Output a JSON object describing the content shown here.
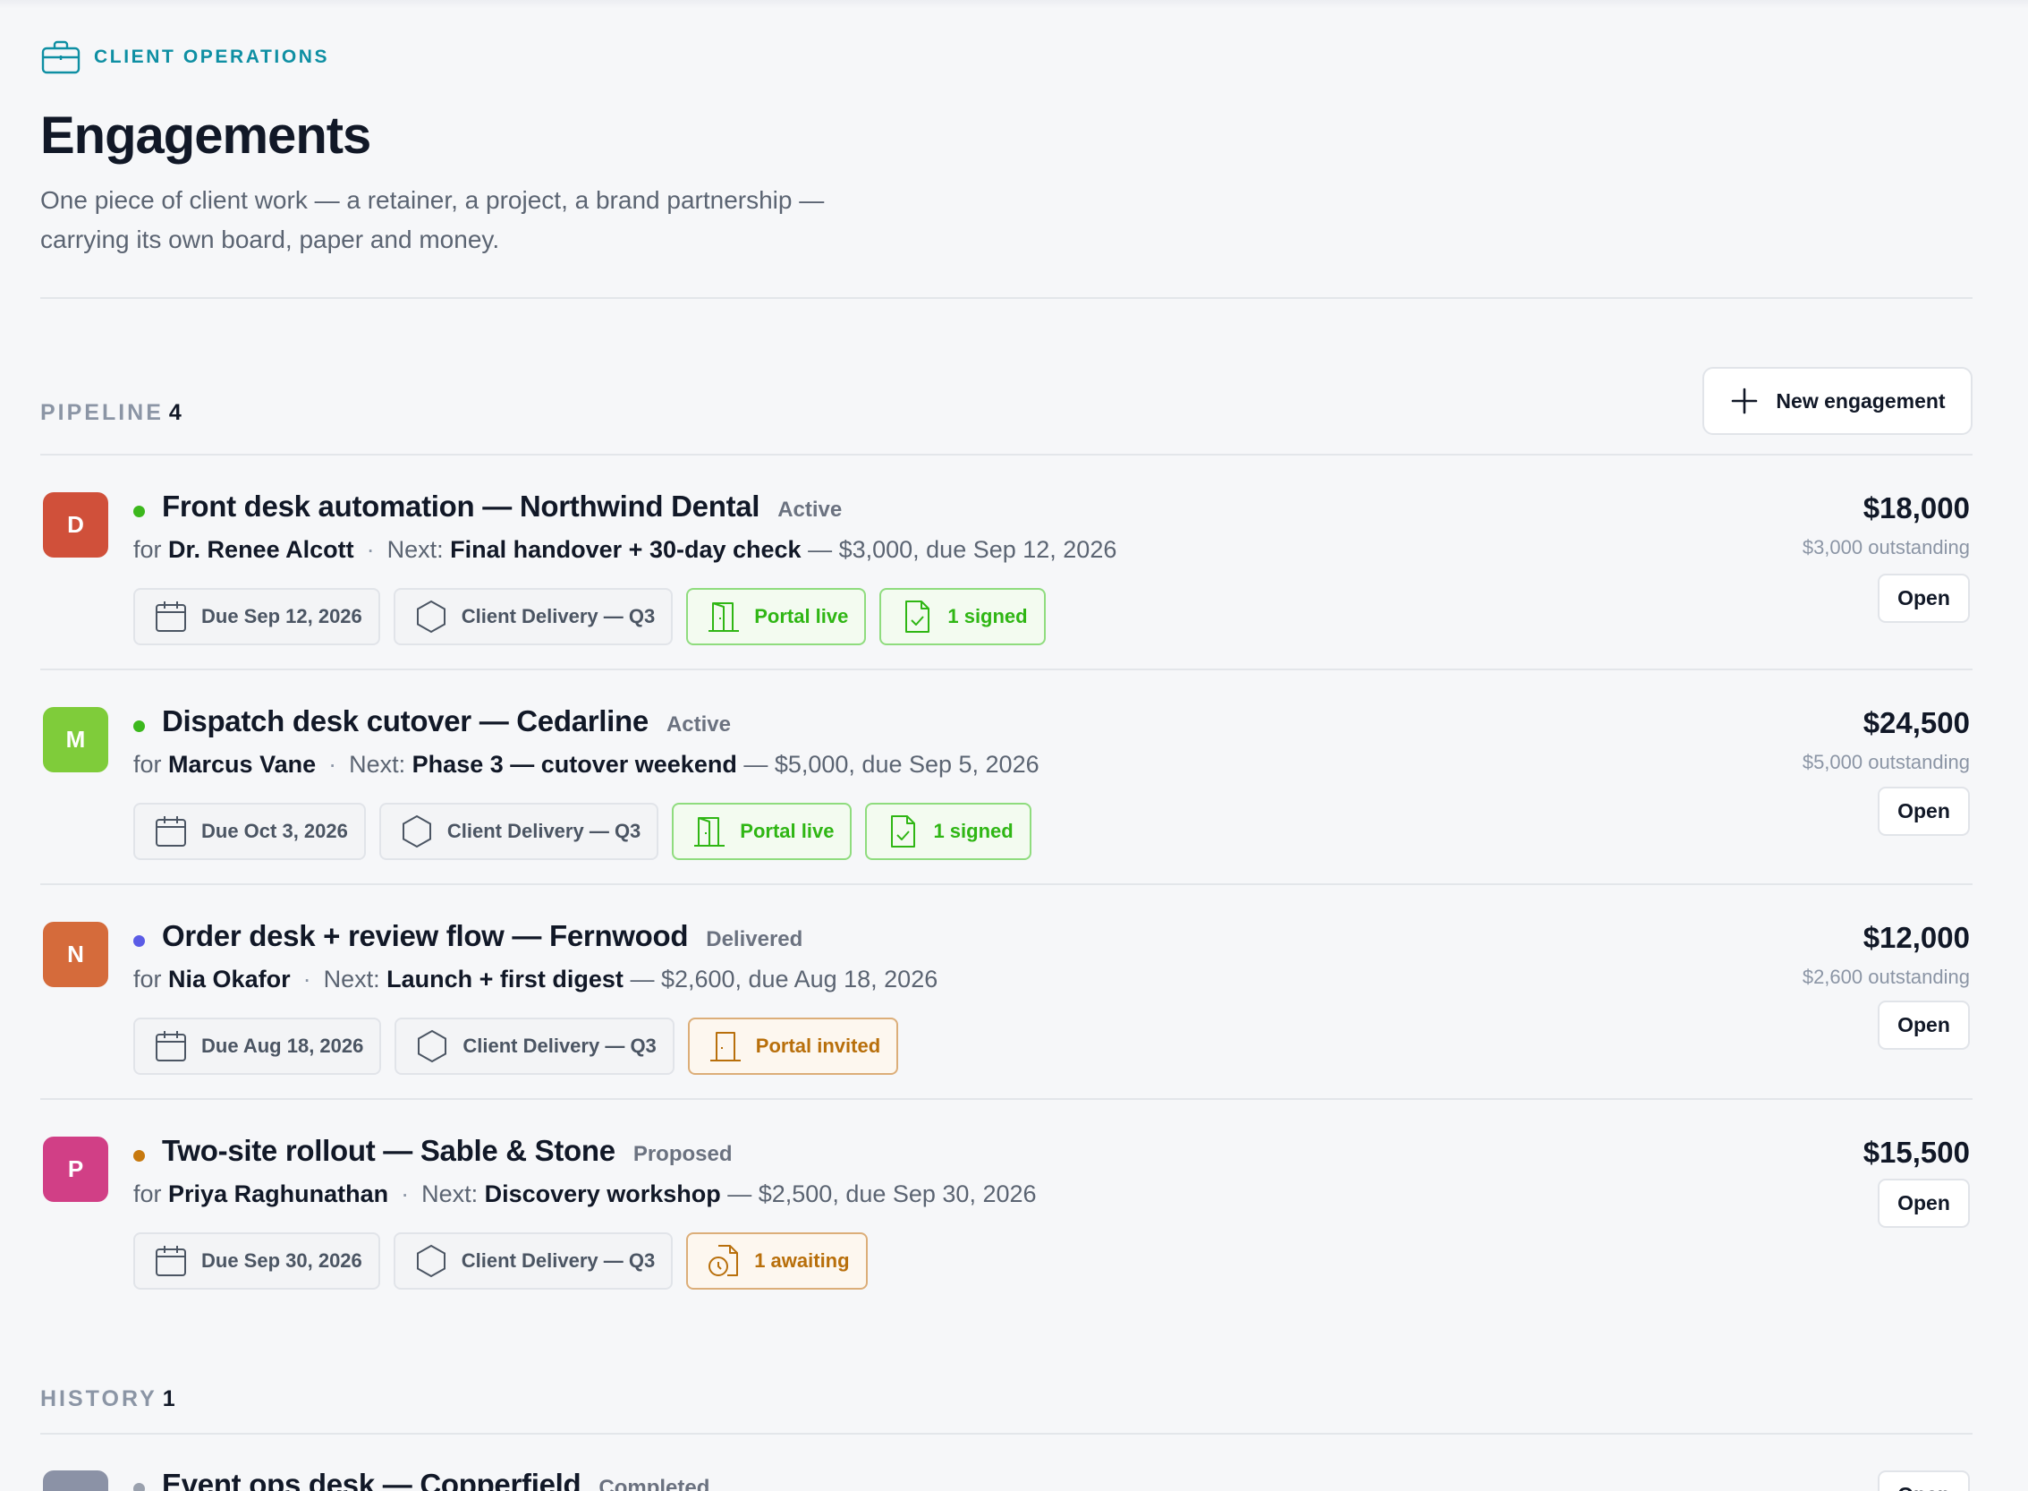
{
  "header": {
    "eyebrow": "CLIENT OPERATIONS",
    "title": "Engagements",
    "subtitle_line1": "One piece of client work — a retainer, a project, a brand partnership —",
    "subtitle_line2": "carrying its own board, paper and money."
  },
  "pipeline": {
    "label": "PIPELINE",
    "count": "4",
    "new_button_label": "New engagement"
  },
  "engagements": [
    {
      "initial": "D",
      "avatar_color": "#d0503a",
      "dot_color": "#3cb81d",
      "title": "Front desk automation — Northwind Dental",
      "status": "Active",
      "for_label": "for",
      "client": "Dr. Renee Alcott",
      "next_label": "Next:",
      "next_task": "Final handover + 30-day check",
      "next_detail": "— $3,000, due Sep 12, 2026",
      "due_chip": "Due Sep 12, 2026",
      "project_chip": "Client Delivery — Q3",
      "portal_chip": "Portal live",
      "doc_chip": "1 signed",
      "amount": "$18,000",
      "outstanding": "$3,000 outstanding",
      "open_label": "Open"
    },
    {
      "initial": "M",
      "avatar_color": "#7fcc3a",
      "dot_color": "#3cb81d",
      "title": "Dispatch desk cutover — Cedarline",
      "status": "Active",
      "for_label": "for",
      "client": "Marcus Vane",
      "next_label": "Next:",
      "next_task": "Phase 3 — cutover weekend",
      "next_detail": "— $5,000, due Sep 5, 2026",
      "due_chip": "Due Oct 3, 2026",
      "project_chip": "Client Delivery — Q3",
      "portal_chip": "Portal live",
      "doc_chip": "1 signed",
      "amount": "$24,500",
      "outstanding": "$5,000 outstanding",
      "open_label": "Open"
    },
    {
      "initial": "N",
      "avatar_color": "#d56b3b",
      "dot_color": "#5b5ce6",
      "title": "Order desk + review flow — Fernwood",
      "status": "Delivered",
      "for_label": "for",
      "client": "Nia Okafor",
      "next_label": "Next:",
      "next_task": "Launch + first digest",
      "next_detail": "— $2,600, due Aug 18, 2026",
      "due_chip": "Due Aug 18, 2026",
      "project_chip": "Client Delivery — Q3",
      "portal_chip": "Portal invited",
      "amount": "$12,000",
      "outstanding": "$2,600 outstanding",
      "open_label": "Open"
    },
    {
      "initial": "P",
      "avatar_color": "#d13f86",
      "dot_color": "#c7790f",
      "title": "Two-site rollout — Sable & Stone",
      "status": "Proposed",
      "for_label": "for",
      "client": "Priya Raghunathan",
      "next_label": "Next:",
      "next_task": "Discovery workshop",
      "next_detail": "— $2,500, due Sep 30, 2026",
      "due_chip": "Due Sep 30, 2026",
      "project_chip": "Client Delivery — Q3",
      "doc_chip": "1 awaiting",
      "amount": "$15,500",
      "open_label": "Open"
    }
  ],
  "history": {
    "label": "HISTORY",
    "count": "1",
    "item": {
      "title": "Event ops desk — Copperfield",
      "status": "Completed",
      "open_label": "Open",
      "avatar_color": "#8b92a6",
      "dot_color": "#9aa1ae"
    }
  }
}
